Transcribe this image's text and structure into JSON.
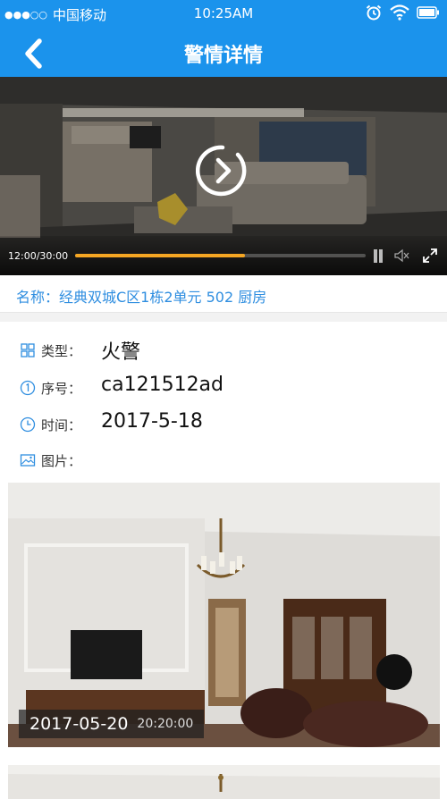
{
  "status_bar": {
    "signal_dots": "●●●○○",
    "carrier": "中国移动",
    "time": "10:25AM",
    "icons": [
      "alarm-icon",
      "wifi-icon",
      "battery-icon"
    ]
  },
  "nav": {
    "back_icon": "chevron-left-icon",
    "title": "警情详情"
  },
  "video": {
    "time_readout": "12:00/30:00",
    "progress": 0.585,
    "controls": [
      "play-icon",
      "pause-icon",
      "mute-icon",
      "fullscreen-icon"
    ]
  },
  "name_row": {
    "text": "名称：经典双城C区1栋2单元 502 厨房"
  },
  "details": {
    "type": {
      "label": "类型：",
      "value": "火警",
      "icon": "grid-icon"
    },
    "serial": {
      "label": "序号：",
      "value": "ca121512ad",
      "icon": "number-one-icon"
    },
    "time": {
      "label": "时间：",
      "value": "2017-5-18",
      "icon": "clock-icon"
    },
    "images": {
      "label": "图片：",
      "icon": "image-icon"
    }
  },
  "photos": [
    {
      "date": "2017-05-20",
      "time": "20:20:00"
    },
    {
      "date": "",
      "time": ""
    }
  ],
  "colors": {
    "header_bg": "#1b93ec",
    "accent_text": "#2f8ee0",
    "progress_fill": "#f5a623"
  }
}
